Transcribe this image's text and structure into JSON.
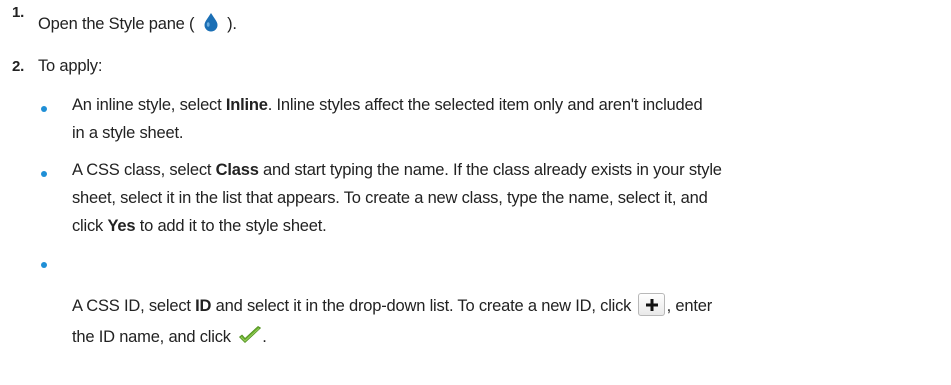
{
  "steps": [
    {
      "number": "1.",
      "text_before": "Open the Style pane (",
      "icon": "water-drop-icon",
      "text_after": ")."
    },
    {
      "number": "2.",
      "text": "To apply:"
    }
  ],
  "bullets": {
    "inline": {
      "prefix": "An inline style, select ",
      "bold": "Inline",
      "suffix": ". Inline styles affect the selected item only and aren't included",
      "line2": "in a style sheet."
    },
    "class": {
      "prefix": "A CSS class, select ",
      "bold": "Class",
      "suffix": " and start typing the name. If the class already exists in your style",
      "line2": "sheet, select it in the list that appears. To create a new class, type the name, select it, and",
      "line3_prefix": "click ",
      "line3_bold": "Yes",
      "line3_suffix": " to add it to the style sheet."
    },
    "id": {
      "prefix": "A CSS ID, select ",
      "bold": "ID",
      "middle": " and select it in the drop-down list. To create a new ID, click",
      "button_icon": "plus-icon",
      "suffix": ", enter",
      "line2": "the ID name, and click",
      "check_icon": "checkmark-icon",
      "line2_end": "."
    }
  },
  "colors": {
    "bullet": "#1f8fd6",
    "drop": "#1b6fb5",
    "check": "#6aae2e"
  }
}
